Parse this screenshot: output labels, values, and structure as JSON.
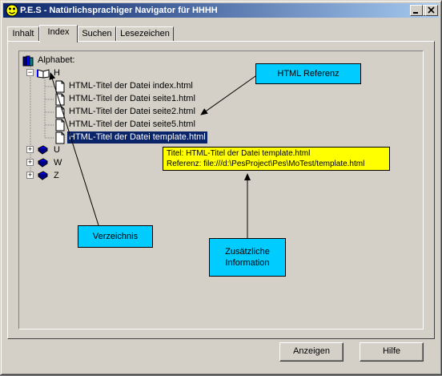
{
  "window": {
    "title": "P.E.S - Natürlichsprachiger Navigator für HHHH"
  },
  "tabs": [
    {
      "label": "Inhalt"
    },
    {
      "label": "Index"
    },
    {
      "label": "Suchen"
    },
    {
      "label": "Lesezeichen"
    }
  ],
  "tree": {
    "root_label": "Alphabet:",
    "open_letter": "H",
    "files": [
      "HTML-Titel der Datei index.html",
      "HTML-Titel der Datei seite1.html",
      "HTML-Titel der Datei seite2.html",
      "HTML-Titel der Datei seite5.html",
      "HTML-Titel der Datei template.html"
    ],
    "collapsed_letters": [
      "U",
      "W",
      "Z"
    ]
  },
  "tooltip": {
    "line1": "Titel: HTML-Titel der Datei template.html",
    "line2": "Referenz: file:///d:\\PesProject\\Pes\\MoTest/template.html"
  },
  "callouts": {
    "html_ref": "HTML Referenz",
    "directory": "Verzeichnis",
    "extra_info_line1": "Zusätzliche",
    "extra_info_line2": "Information"
  },
  "buttons": {
    "show": "Anzeigen",
    "help": "Hilfe"
  },
  "colors": {
    "titlebar": "#0a246a",
    "selection": "#0a246a",
    "callout": "#00ccff",
    "tooltip": "#ffff00"
  }
}
